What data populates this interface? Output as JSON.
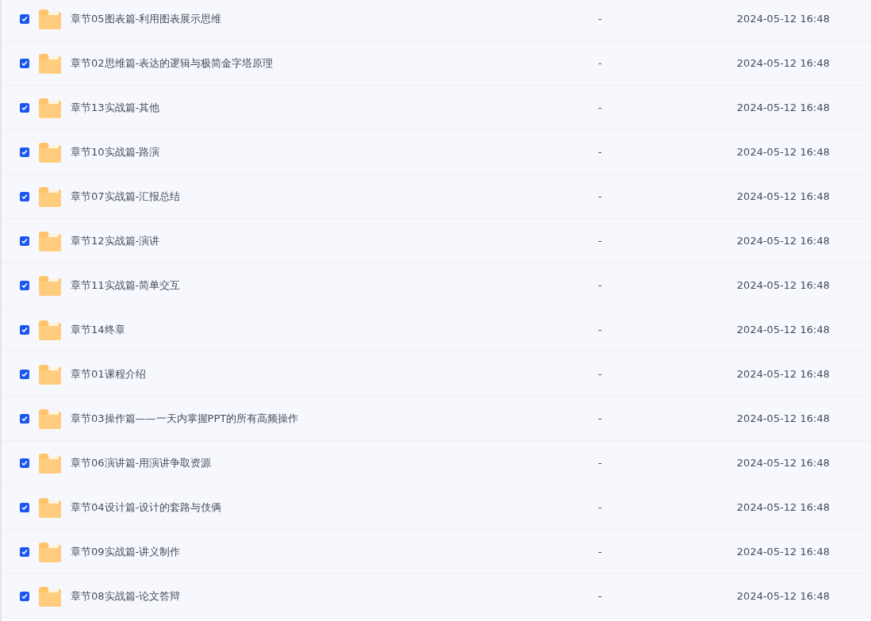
{
  "files": [
    {
      "name": "章节05图表篇-利用图表展示思维",
      "size": "-",
      "modified": "2024-05-12 16:48",
      "checked": true
    },
    {
      "name": "章节02思维篇-表达的逻辑与极简金字塔原理",
      "size": "-",
      "modified": "2024-05-12 16:48",
      "checked": true
    },
    {
      "name": "章节13实战篇-其他",
      "size": "-",
      "modified": "2024-05-12 16:48",
      "checked": true
    },
    {
      "name": "章节10实战篇-路演",
      "size": "-",
      "modified": "2024-05-12 16:48",
      "checked": true
    },
    {
      "name": "章节07实战篇-汇报总结",
      "size": "-",
      "modified": "2024-05-12 16:48",
      "checked": true
    },
    {
      "name": "章节12实战篇-演讲",
      "size": "-",
      "modified": "2024-05-12 16:48",
      "checked": true
    },
    {
      "name": "章节11实战篇-简单交互",
      "size": "-",
      "modified": "2024-05-12 16:48",
      "checked": true
    },
    {
      "name": "章节14终章",
      "size": "-",
      "modified": "2024-05-12 16:48",
      "checked": true
    },
    {
      "name": "章节01课程介绍",
      "size": "-",
      "modified": "2024-05-12 16:48",
      "checked": true
    },
    {
      "name": "章节03操作篇——一天内掌握PPT的所有高频操作",
      "size": "-",
      "modified": "2024-05-12 16:48",
      "checked": true
    },
    {
      "name": "章节06演讲篇-用演讲争取资源",
      "size": "-",
      "modified": "2024-05-12 16:48",
      "checked": true
    },
    {
      "name": "章节04设计篇-设计的套路与伎俩",
      "size": "-",
      "modified": "2024-05-12 16:48",
      "checked": true
    },
    {
      "name": "章节09实战篇-讲义制作",
      "size": "-",
      "modified": "2024-05-12 16:48",
      "checked": true
    },
    {
      "name": "章节08实战篇-论文答辩",
      "size": "-",
      "modified": "2024-05-12 16:48",
      "checked": true
    }
  ]
}
